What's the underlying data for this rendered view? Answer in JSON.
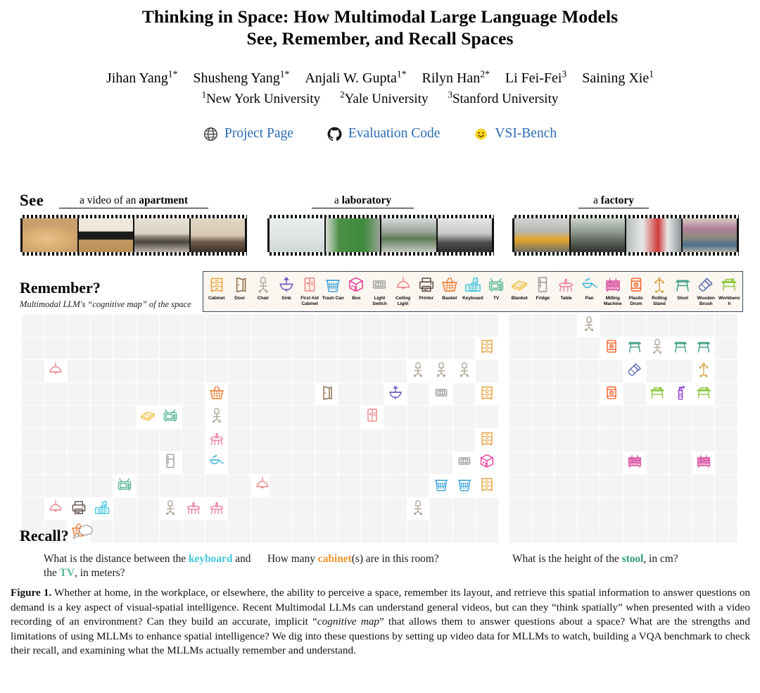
{
  "title": {
    "line1": "Thinking in Space: How Multimodal Large Language Models",
    "line2": "See, Remember, and Recall Spaces"
  },
  "authors": [
    {
      "name": "Jihan Yang",
      "sup": "1*"
    },
    {
      "name": "Shusheng Yang",
      "sup": "1*"
    },
    {
      "name": "Anjali W. Gupta",
      "sup": "1*"
    },
    {
      "name": "Rilyn Han",
      "sup": "2*"
    },
    {
      "name": "Li Fei-Fei",
      "sup": "3"
    },
    {
      "name": "Saining Xie",
      "sup": "1"
    }
  ],
  "affiliations": [
    {
      "sup": "1",
      "name": "New York University"
    },
    {
      "sup": "2",
      "name": "Yale University"
    },
    {
      "sup": "3",
      "name": "Stanford University"
    }
  ],
  "links": [
    {
      "icon": "globe-icon",
      "label": "Project Page",
      "color": "#2a6bb5"
    },
    {
      "icon": "github-icon",
      "label": "Evaluation Code",
      "color": "#2a6bb5"
    },
    {
      "icon": "hugging-face-icon",
      "label": "VSI-Bench",
      "color": "#2a6bb5"
    }
  ],
  "see": {
    "label": "See",
    "videos": [
      {
        "prefix": "a video of an ",
        "strong": "apartment"
      },
      {
        "prefix": "a ",
        "strong": "laboratory"
      },
      {
        "prefix": "a ",
        "strong": "factory"
      }
    ]
  },
  "remember": {
    "label": "Remember?",
    "subtitle": "Multimodal LLM's “cognitive map” of the space"
  },
  "legend": [
    {
      "name": "Cabinet",
      "icon": "cabinet",
      "color": "#e8a33d"
    },
    {
      "name": "Door",
      "icon": "door",
      "color": "#8a6a45"
    },
    {
      "name": "Chair",
      "icon": "chair",
      "color": "#b0a89a"
    },
    {
      "name": "Sink",
      "icon": "sink",
      "color": "#6a5ec4"
    },
    {
      "name": "First Aid Cabinet",
      "icon": "first-aid",
      "color": "#ef7f80"
    },
    {
      "name": "Trash Can",
      "icon": "trash-can",
      "color": "#39a3db"
    },
    {
      "name": "Box",
      "icon": "box",
      "color": "#ec3f9e"
    },
    {
      "name": "Light Switch",
      "icon": "light-switch",
      "color": "#9a9a9a"
    },
    {
      "name": "Ceiling Light",
      "icon": "ceiling-light",
      "color": "#ef8a8f"
    },
    {
      "name": "Printer",
      "icon": "printer",
      "color": "#5e4a42"
    },
    {
      "name": "Basket",
      "icon": "basket",
      "color": "#f47b32"
    },
    {
      "name": "Keyboard",
      "icon": "keyboard",
      "color": "#3fc6de"
    },
    {
      "name": "TV",
      "icon": "tv",
      "color": "#59b896"
    },
    {
      "name": "Blanket",
      "icon": "blanket",
      "color": "#f2c34b"
    },
    {
      "name": "Fridge",
      "icon": "fridge",
      "color": "#9a9a9a"
    },
    {
      "name": "Table",
      "icon": "table",
      "color": "#ef7fa4"
    },
    {
      "name": "Pan",
      "icon": "pan",
      "color": "#3fb5d8"
    },
    {
      "name": "Milling Machine",
      "icon": "milling-machine",
      "color": "#d94fa0"
    },
    {
      "name": "Plastic Drum",
      "icon": "plastic-drum",
      "color": "#f4622a"
    },
    {
      "name": "Rolling Stand",
      "icon": "rolling-stand",
      "color": "#d8a44a"
    },
    {
      "name": "Stool",
      "icon": "stool",
      "color": "#3f9e84"
    },
    {
      "name": "Wooden Brush",
      "icon": "wooden-brush",
      "color": "#5566b0"
    },
    {
      "name": "Workbench",
      "icon": "workbench",
      "color": "#8ec63f"
    }
  ],
  "maps": [
    {
      "name": "apartment-cognitive-map",
      "cols": 11,
      "rows": 10,
      "items": [
        {
          "icon": "ceiling-light",
          "col": 1,
          "row": 2
        },
        {
          "icon": "basket",
          "col": 8,
          "row": 3
        },
        {
          "icon": "blanket",
          "col": 5,
          "row": 4
        },
        {
          "icon": "tv",
          "col": 6,
          "row": 4
        },
        {
          "icon": "chair",
          "col": 8,
          "row": 4
        },
        {
          "icon": "table",
          "col": 8,
          "row": 5
        },
        {
          "icon": "fridge",
          "col": 6,
          "row": 6
        },
        {
          "icon": "pan",
          "col": 8,
          "row": 6
        },
        {
          "icon": "tv",
          "col": 4,
          "row": 7
        },
        {
          "icon": "ceiling-light",
          "col": 10,
          "row": 7
        },
        {
          "icon": "ceiling-light",
          "col": 1,
          "row": 8
        },
        {
          "icon": "printer",
          "col": 2,
          "row": 8
        },
        {
          "icon": "keyboard",
          "col": 3,
          "row": 8
        },
        {
          "icon": "chair",
          "col": 6,
          "row": 8
        },
        {
          "icon": "table",
          "col": 7,
          "row": 8
        },
        {
          "icon": "table",
          "col": 8,
          "row": 8
        },
        {
          "icon": "basket",
          "col": 2,
          "row": 9
        }
      ]
    },
    {
      "name": "laboratory-cognitive-map",
      "cols": 10,
      "rows": 10,
      "items": [
        {
          "icon": "cabinet",
          "col": 9,
          "row": 1
        },
        {
          "icon": "chair",
          "col": 6,
          "row": 2
        },
        {
          "icon": "chair",
          "col": 7,
          "row": 2
        },
        {
          "icon": "chair",
          "col": 8,
          "row": 2
        },
        {
          "icon": "door",
          "col": 2,
          "row": 3
        },
        {
          "icon": "sink",
          "col": 5,
          "row": 3
        },
        {
          "icon": "light-switch",
          "col": 7,
          "row": 3
        },
        {
          "icon": "cabinet",
          "col": 9,
          "row": 3
        },
        {
          "icon": "first-aid",
          "col": 4,
          "row": 4
        },
        {
          "icon": "cabinet",
          "col": 9,
          "row": 5
        },
        {
          "icon": "light-switch",
          "col": 8,
          "row": 6
        },
        {
          "icon": "box",
          "col": 9,
          "row": 6
        },
        {
          "icon": "trash-can",
          "col": 7,
          "row": 7
        },
        {
          "icon": "trash-can",
          "col": 8,
          "row": 7
        },
        {
          "icon": "cabinet",
          "col": 9,
          "row": 7
        },
        {
          "icon": "chair",
          "col": 6,
          "row": 8
        }
      ]
    },
    {
      "name": "factory-cognitive-map",
      "cols": 10,
      "rows": 10,
      "items": [
        {
          "icon": "chair",
          "col": 3,
          "row": 0
        },
        {
          "icon": "plastic-drum",
          "col": 4,
          "row": 1
        },
        {
          "icon": "stool",
          "col": 5,
          "row": 1
        },
        {
          "icon": "chair",
          "col": 6,
          "row": 1
        },
        {
          "icon": "stool",
          "col": 7,
          "row": 1
        },
        {
          "icon": "stool",
          "col": 8,
          "row": 1
        },
        {
          "icon": "wooden-brush",
          "col": 5,
          "row": 2
        },
        {
          "icon": "rolling-stand",
          "col": 8,
          "row": 2
        },
        {
          "icon": "plastic-drum",
          "col": 4,
          "row": 3
        },
        {
          "icon": "workbench",
          "col": 6,
          "row": 3
        },
        {
          "icon": "spray-bottle",
          "col": 7,
          "row": 3
        },
        {
          "icon": "workbench",
          "col": 8,
          "row": 3
        },
        {
          "icon": "milling-machine",
          "col": 5,
          "row": 6
        },
        {
          "icon": "milling-machine",
          "col": 8,
          "row": 6
        }
      ]
    }
  ],
  "recall": {
    "label": "Recall?",
    "questions": [
      {
        "parts": [
          {
            "text": "What is the distance between the ",
            "style": "plain"
          },
          {
            "text": "keyboard",
            "style": "accent",
            "color": "#3fc6de"
          },
          {
            "text": " and the ",
            "style": "plain"
          },
          {
            "text": "TV",
            "style": "accent",
            "color": "#59b896"
          },
          {
            "text": ", in meters?",
            "style": "plain"
          }
        ]
      },
      {
        "parts": [
          {
            "text": "How many ",
            "style": "plain"
          },
          {
            "text": "cabinet",
            "style": "accent",
            "color": "#f0932b"
          },
          {
            "text": "(s) are in this room?",
            "style": "plain"
          }
        ]
      },
      {
        "parts": [
          {
            "text": "What is the height of  the ",
            "style": "plain"
          },
          {
            "text": "stool",
            "style": "accent",
            "color": "#2f9e6e"
          },
          {
            "text": ", in cm?",
            "style": "plain"
          }
        ]
      }
    ]
  },
  "caption": {
    "figure_label": "Figure 1.",
    "text_before": " Whether at home, in the workplace, or elsewhere, the ability to perceive a space, remember its layout, and retrieve this spatial information to answer questions on demand is a key aspect of visual-spatial intelligence. Recent Multimodal LLMs can understand general videos, but can they “think spatially” when presented with a video recording of an environment? Can they build an accurate, implicit “",
    "italic": "cognitive map",
    "text_after": "” that allows them to answer questions about a space? What are the strengths and limitations of using MLLMs to enhance spatial intelligence? We dig into these questions by setting up video data for MLLMs to watch, building a VQA benchmark to check their recall, and examining what the MLLMs actually remember and understand."
  }
}
